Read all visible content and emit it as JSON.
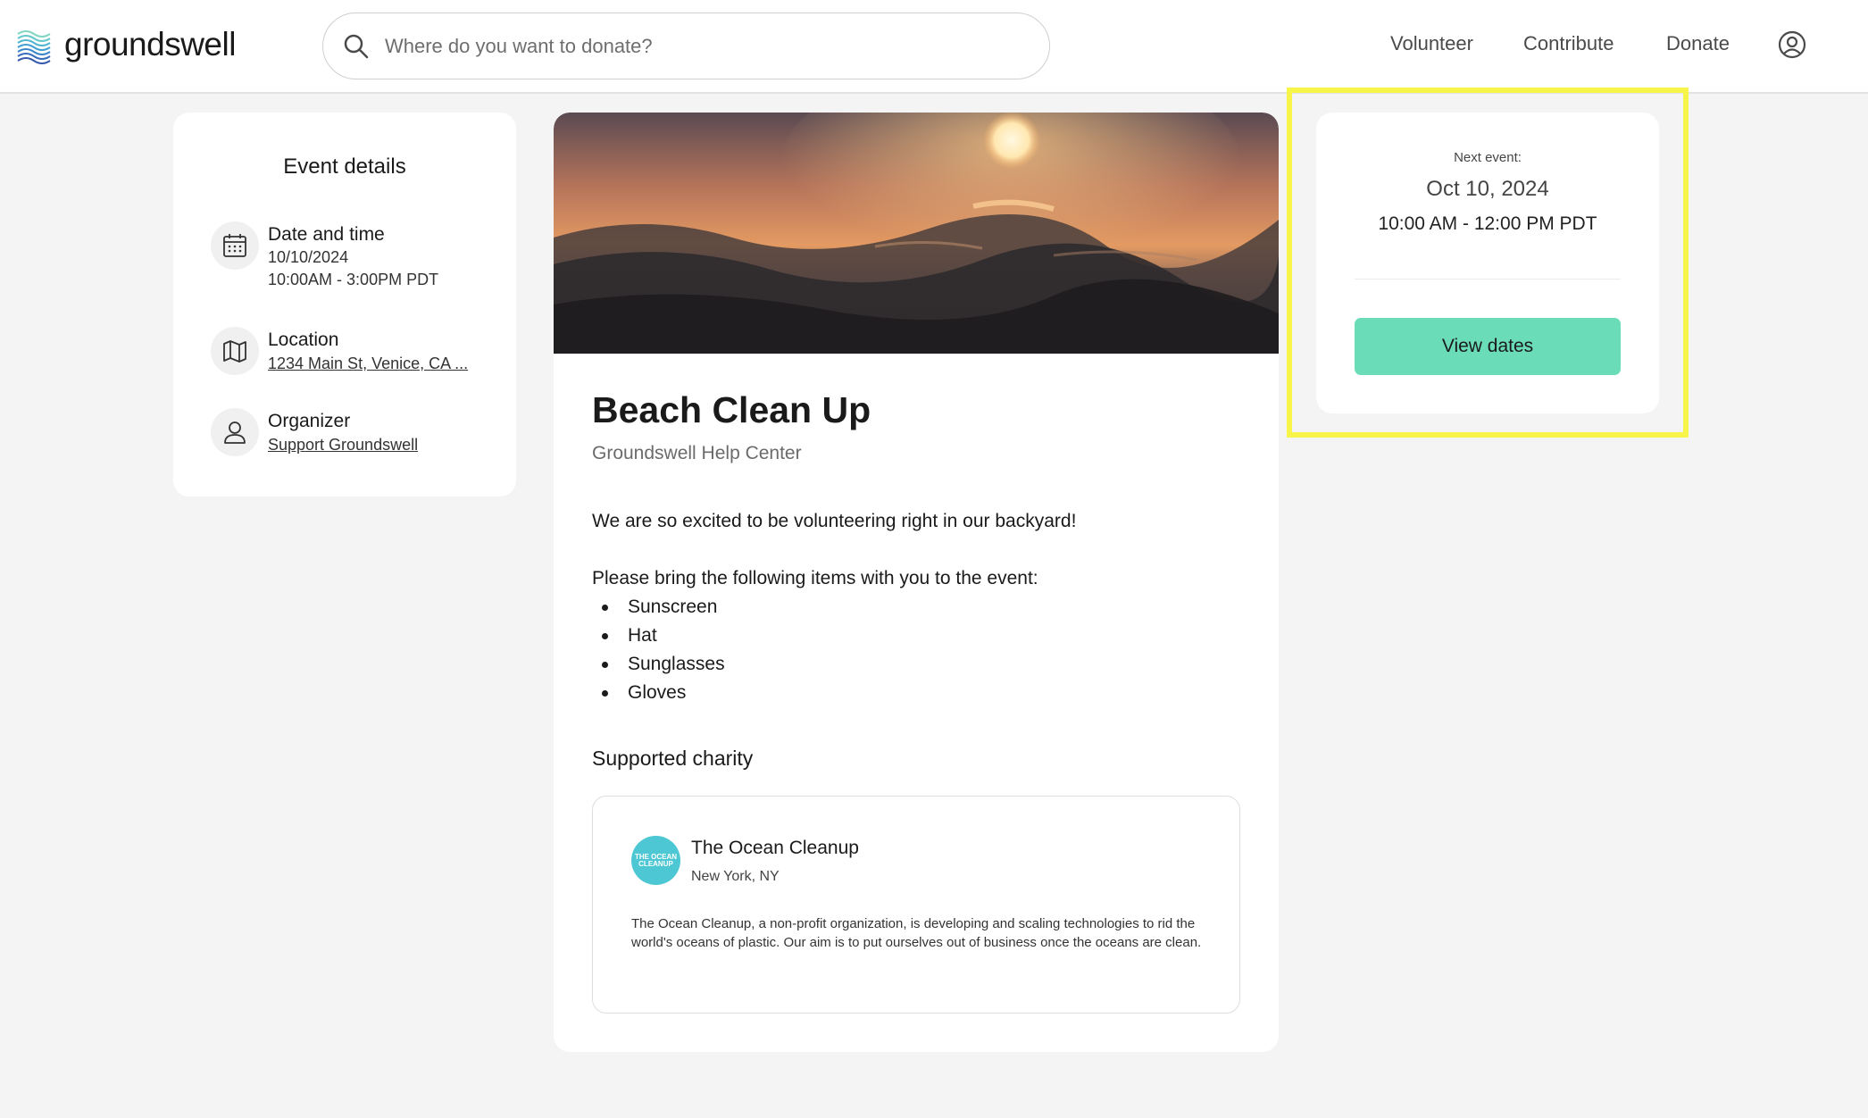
{
  "header": {
    "logo_text": "groundswell",
    "search_placeholder": "Where do you want to donate?",
    "nav": [
      "Volunteer",
      "Contribute",
      "Donate"
    ]
  },
  "event_details": {
    "title": "Event details",
    "date_label": "Date and time",
    "date": "10/10/2024",
    "time": "10:00AM - 3:00PM PDT",
    "location_label": "Location",
    "location": "1234 Main St, Venice, CA ...",
    "organizer_label": "Organizer",
    "organizer": "Support Groundswell"
  },
  "event": {
    "title": "Beach Clean Up",
    "organization": "Groundswell Help Center",
    "description": "We are so excited to be volunteering right in our backyard!",
    "bring_intro": "Please bring the following items with you to the event:",
    "items": [
      "Sunscreen",
      "Hat",
      "Sunglasses",
      "Gloves"
    ]
  },
  "charity": {
    "heading": "Supported charity",
    "logo_text": "THE OCEAN CLEANUP",
    "name": "The Ocean Cleanup",
    "location": "New York, NY",
    "description": "The Ocean Cleanup, a non-profit organization, is developing and scaling technologies to rid the world's oceans of plastic. Our aim is to put ourselves out of business once the oceans are clean."
  },
  "next_event": {
    "label": "Next event:",
    "date": "Oct 10, 2024",
    "time": "10:00 AM - 12:00 PM PDT",
    "button_label": "View dates"
  },
  "colors": {
    "accent_button": "#6adcb8",
    "highlight_border": "#f7f44a",
    "charity_logo": "#4ec7d4"
  }
}
